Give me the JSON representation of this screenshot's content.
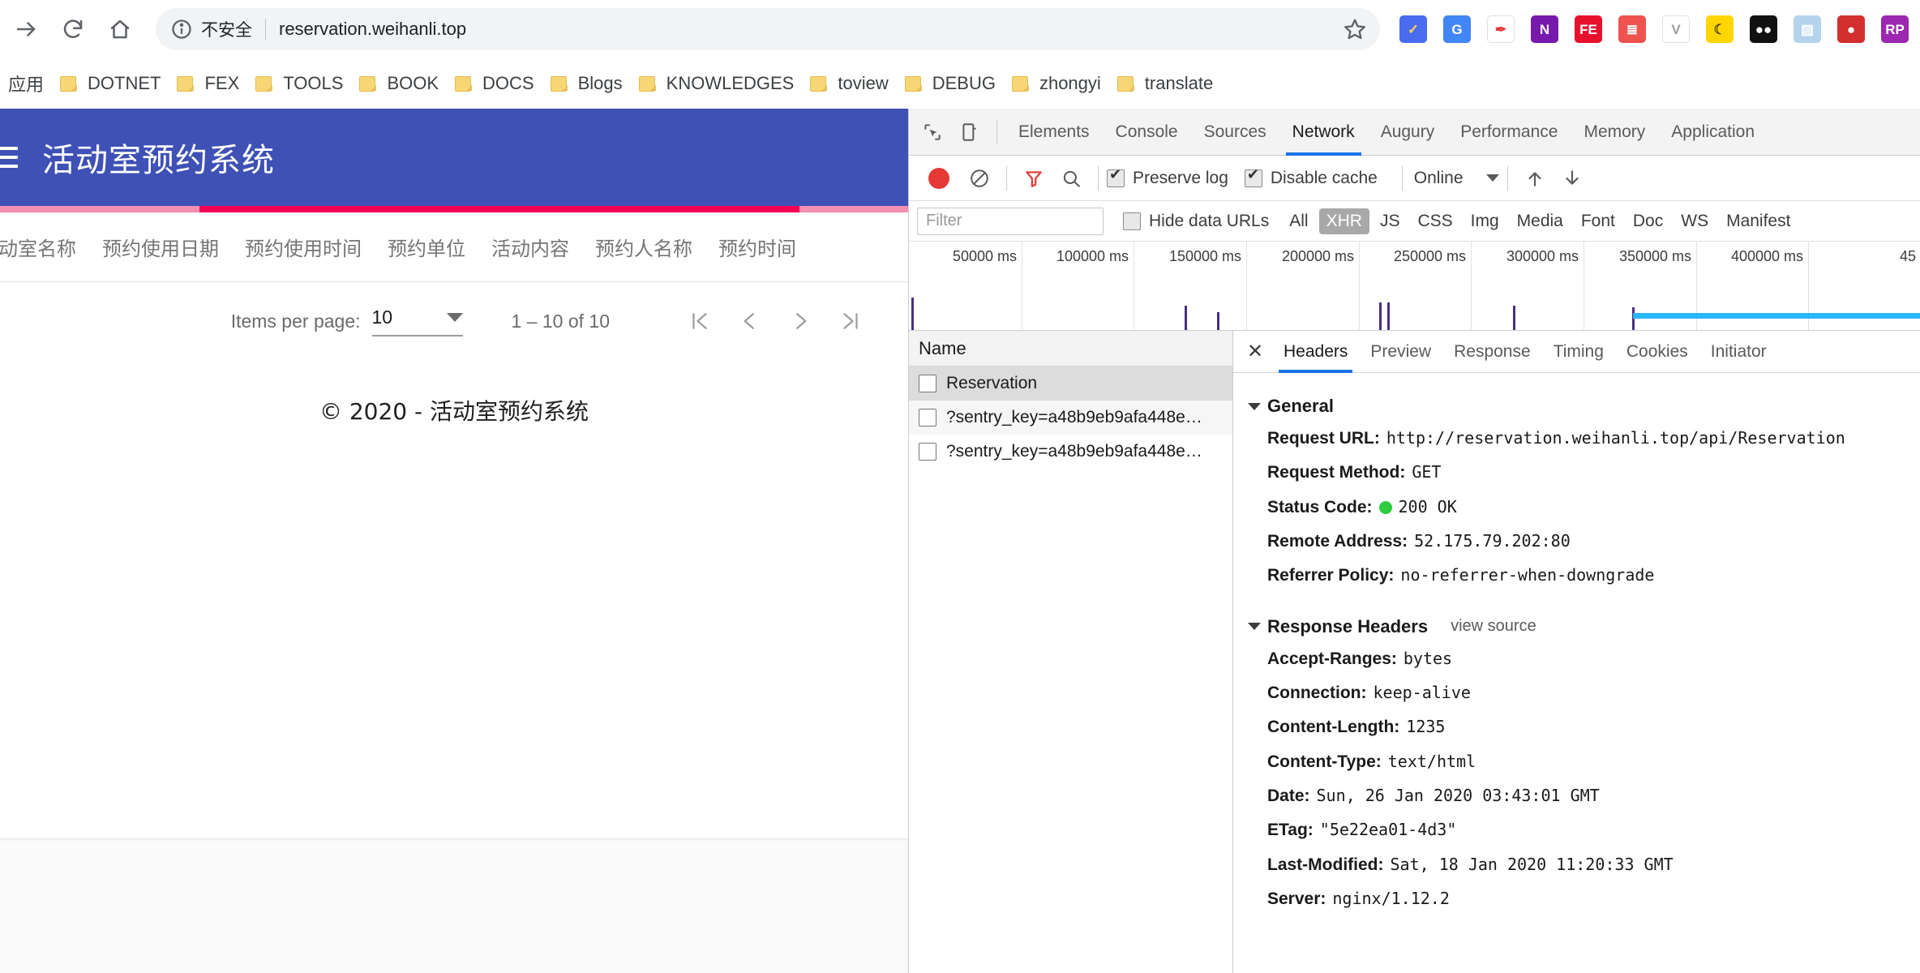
{
  "browser": {
    "nav": {
      "forward_icon": "arrow-forward-icon",
      "reload_icon": "reload-icon",
      "home_icon": "home-icon"
    },
    "omnibox": {
      "security_icon": "info-circle-icon",
      "security_text": "不安全",
      "url": "reservation.weihanli.top",
      "star_icon": "star-icon"
    },
    "extensions": [
      {
        "name": "checkmark-extension-icon",
        "glyph": "✓",
        "bg": "#4a6cf0",
        "fg": "#ffd54f"
      },
      {
        "name": "google-translate-extension-icon",
        "glyph": "G",
        "bg": "#4285f4",
        "fg": "#ffffff"
      },
      {
        "name": "pen-circle-extension-icon",
        "glyph": "✒",
        "bg": "#ffffff",
        "fg": "#e53935"
      },
      {
        "name": "onenote-extension-icon",
        "glyph": "N",
        "bg": "#7719aa",
        "fg": "#ffffff"
      },
      {
        "name": "fe-extension-icon",
        "glyph": "FE",
        "bg": "#e8112d",
        "fg": "#ffffff"
      },
      {
        "name": "notes-extension-icon",
        "glyph": "≣",
        "bg": "#ef5350",
        "fg": "#ffffff"
      },
      {
        "name": "vue-devtools-extension-icon",
        "glyph": "V",
        "bg": "#ffffff",
        "fg": "#9e9e9e"
      },
      {
        "name": "moon-extension-icon",
        "glyph": "☾",
        "bg": "#ffd600",
        "fg": "#5b4b00"
      },
      {
        "name": "black-eyes-extension-icon",
        "glyph": "●●",
        "bg": "#111111",
        "fg": "#ffffff"
      },
      {
        "name": "image-extension-icon",
        "glyph": "▨",
        "bg": "#b3d4ec",
        "fg": "#ffffff"
      },
      {
        "name": "record-extension-icon",
        "glyph": "●",
        "bg": "#d32f2f",
        "fg": "#ffffff"
      },
      {
        "name": "rp-extension-icon",
        "glyph": "RP",
        "bg": "#9c27b0",
        "fg": "#ffffff"
      }
    ],
    "bookmarks": [
      {
        "label": "应用",
        "has_folder": false
      },
      {
        "label": "DOTNET",
        "has_folder": true
      },
      {
        "label": "FEX",
        "has_folder": true
      },
      {
        "label": "TOOLS",
        "has_folder": true
      },
      {
        "label": "BOOK",
        "has_folder": true
      },
      {
        "label": "DOCS",
        "has_folder": true
      },
      {
        "label": "Blogs",
        "has_folder": true
      },
      {
        "label": "KNOWLEDGES",
        "has_folder": true
      },
      {
        "label": "toview",
        "has_folder": true
      },
      {
        "label": "DEBUG",
        "has_folder": true
      },
      {
        "label": "zhongyi",
        "has_folder": true
      },
      {
        "label": "translate",
        "has_folder": true
      }
    ]
  },
  "page": {
    "toolbar": {
      "menu_icon": "hamburger-menu-icon",
      "title": "活动室预约系统",
      "bg_color": "#3f51b5"
    },
    "progress": {
      "color": "#f50057",
      "track_color": "#f48fb1"
    },
    "table": {
      "columns": [
        "活动室名称",
        "预约使用日期",
        "预约使用时间",
        "预约单位",
        "活动内容",
        "预约人名称",
        "预约时间"
      ],
      "rows": []
    },
    "paginator": {
      "items_per_page_label": "Items per page:",
      "items_per_page_value": "10",
      "range_label": "1 – 10 of 10",
      "first_page_icon": "first-page-icon",
      "prev_page_icon": "previous-page-icon",
      "next_page_icon": "next-page-icon",
      "last_page_icon": "last-page-icon"
    },
    "footer": "© 2020 - 活动室预约系统"
  },
  "devtools": {
    "inspect_icon": "inspect-element-icon",
    "device_icon": "toggle-device-toolbar-icon",
    "tabs": [
      {
        "label": "Elements",
        "active": false
      },
      {
        "label": "Console",
        "active": false
      },
      {
        "label": "Sources",
        "active": false
      },
      {
        "label": "Network",
        "active": true
      },
      {
        "label": "Augury",
        "active": false
      },
      {
        "label": "Performance",
        "active": false
      },
      {
        "label": "Memory",
        "active": false
      },
      {
        "label": "Application",
        "active": false
      }
    ],
    "network_toolbar": {
      "record_icon": "record-button-icon",
      "clear_icon": "clear-network-log-icon",
      "filter_icon": "filter-funnel-icon",
      "search_icon": "search-icon",
      "preserve_log_label": "Preserve log",
      "preserve_log_checked": true,
      "disable_cache_label": "Disable cache",
      "disable_cache_checked": true,
      "throttle_value": "Online",
      "import_icon": "import-har-icon",
      "export_icon": "export-har-icon"
    },
    "filter_bar": {
      "filter_placeholder": "Filter",
      "filter_value": "",
      "hide_data_urls_label": "Hide data URLs",
      "hide_data_urls_checked": false,
      "types": [
        {
          "label": "All",
          "active": false
        },
        {
          "label": "XHR",
          "active": true
        },
        {
          "label": "JS",
          "active": false
        },
        {
          "label": "CSS",
          "active": false
        },
        {
          "label": "Img",
          "active": false
        },
        {
          "label": "Media",
          "active": false
        },
        {
          "label": "Font",
          "active": false
        },
        {
          "label": "Doc",
          "active": false
        },
        {
          "label": "WS",
          "active": false
        },
        {
          "label": "Manifest",
          "active": false
        }
      ]
    },
    "timeline": {
      "ticks": [
        "50000 ms",
        "100000 ms",
        "150000 ms",
        "200000 ms",
        "250000 ms",
        "300000 ms",
        "350000 ms",
        "400000 ms",
        "45"
      ],
      "marker_color": "#4b2e83",
      "bar_color": "#29b6f6"
    },
    "request_list": {
      "header": "Name",
      "rows": [
        {
          "name": "Reservation",
          "selected": true
        },
        {
          "name": "?sentry_key=a48b9eb9afa448e…",
          "selected": false
        },
        {
          "name": "?sentry_key=a48b9eb9afa448e…",
          "selected": false
        }
      ]
    },
    "detail": {
      "close_icon": "close-icon",
      "tabs": [
        {
          "label": "Headers",
          "active": true
        },
        {
          "label": "Preview",
          "active": false
        },
        {
          "label": "Response",
          "active": false
        },
        {
          "label": "Timing",
          "active": false
        },
        {
          "label": "Cookies",
          "active": false
        },
        {
          "label": "Initiator",
          "active": false
        }
      ],
      "general": {
        "title": "General",
        "rows": [
          {
            "name": "Request URL:",
            "value": "http://reservation.weihanli.top/api/Reservation",
            "status": false
          },
          {
            "name": "Request Method:",
            "value": "GET",
            "status": false
          },
          {
            "name": "Status Code:",
            "value": "200 OK",
            "status": true
          },
          {
            "name": "Remote Address:",
            "value": "52.175.79.202:80",
            "status": false
          },
          {
            "name": "Referrer Policy:",
            "value": "no-referrer-when-downgrade",
            "status": false
          }
        ]
      },
      "response_headers": {
        "title": "Response Headers",
        "view_source": "view source",
        "rows": [
          {
            "name": "Accept-Ranges:",
            "value": "bytes"
          },
          {
            "name": "Connection:",
            "value": "keep-alive"
          },
          {
            "name": "Content-Length:",
            "value": "1235"
          },
          {
            "name": "Content-Type:",
            "value": "text/html"
          },
          {
            "name": "Date:",
            "value": "Sun, 26 Jan 2020 03:43:01 GMT"
          },
          {
            "name": "ETag:",
            "value": "\"5e22ea01-4d3\""
          },
          {
            "name": "Last-Modified:",
            "value": "Sat, 18 Jan 2020 11:20:33 GMT"
          },
          {
            "name": "Server:",
            "value": "nginx/1.12.2"
          }
        ]
      }
    }
  }
}
